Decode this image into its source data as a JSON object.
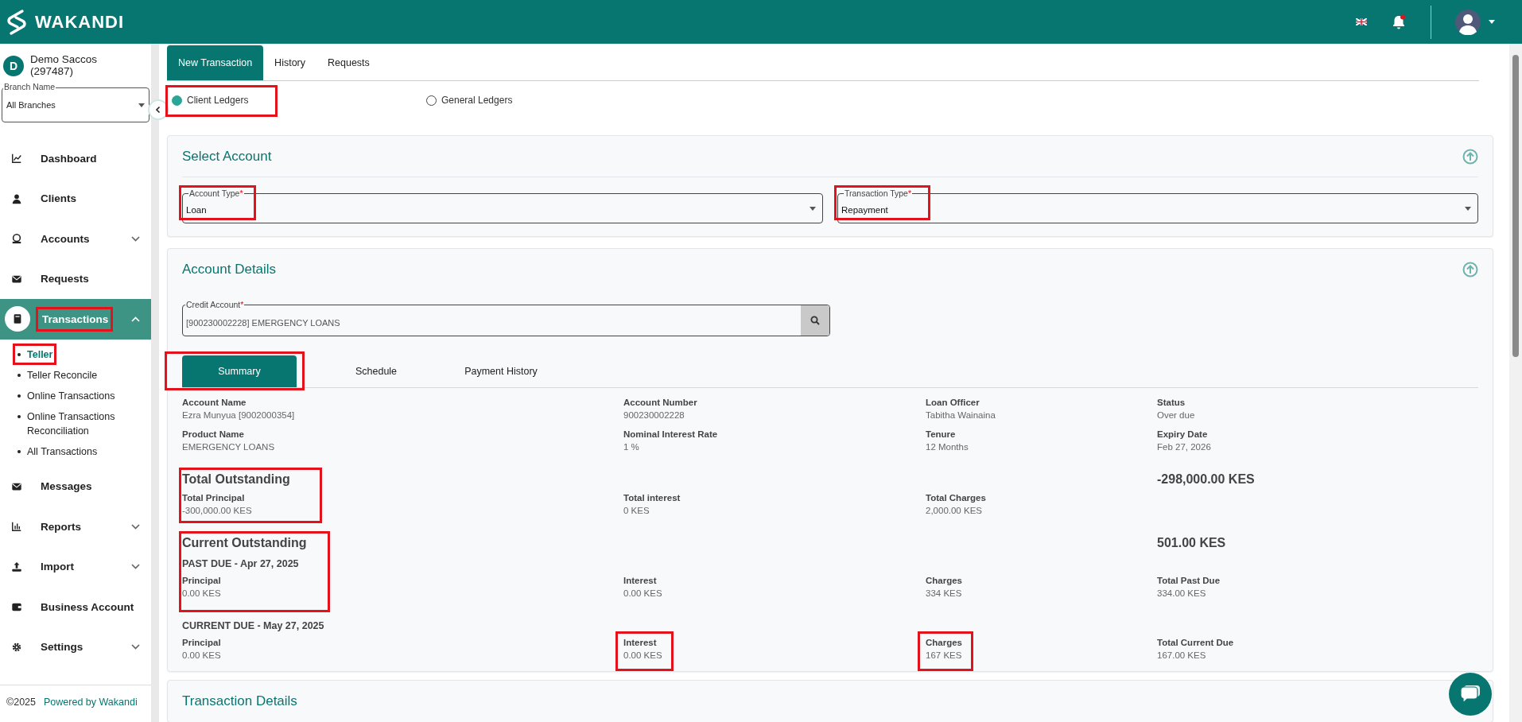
{
  "header": {
    "brand": "WAKANDI"
  },
  "sidebar": {
    "org_initial": "D",
    "org_name": "Demo Saccos",
    "org_code": "(297487)",
    "branch": {
      "label": "Branch Name",
      "value": "All Branches"
    },
    "items": [
      {
        "label": "Dashboard",
        "selected": false,
        "annotated": false
      },
      {
        "label": "Clients",
        "selected": false,
        "annotated": false
      },
      {
        "label": "Accounts",
        "selected": false,
        "annotated": false,
        "expanded": false
      },
      {
        "label": "Requests",
        "selected": false,
        "annotated": false
      },
      {
        "label": "Transactions",
        "selected": true,
        "annotated": true,
        "expanded": true,
        "children": [
          {
            "label": "Teller",
            "selected": true,
            "annotated": true
          },
          {
            "label": "Teller Reconcile",
            "selected": false,
            "annotated": false
          },
          {
            "label": "Online Transactions",
            "selected": false,
            "annotated": false
          },
          {
            "label": "Online Transactions Reconciliation",
            "selected": false,
            "annotated": false
          },
          {
            "label": "All Transactions",
            "selected": false,
            "annotated": false
          }
        ]
      },
      {
        "label": "Messages",
        "selected": false,
        "annotated": false
      },
      {
        "label": "Reports",
        "selected": false,
        "annotated": false,
        "expanded": false
      },
      {
        "label": "Import",
        "selected": false,
        "annotated": false,
        "expanded": false
      },
      {
        "label": "Business Account",
        "selected": false,
        "annotated": false
      },
      {
        "label": "Settings",
        "selected": false,
        "annotated": false,
        "expanded": false
      }
    ],
    "footer": {
      "copyright": "©2025",
      "link": "Powered by Wakandi"
    }
  },
  "tabs": [
    {
      "label": "New Transaction",
      "selected": true
    },
    {
      "label": "History",
      "selected": false
    },
    {
      "label": "Requests",
      "selected": false
    }
  ],
  "ledger_options": [
    {
      "label": "Client Ledgers",
      "selected": true,
      "annotated": true
    },
    {
      "label": "General Ledgers",
      "selected": false,
      "annotated": false
    }
  ],
  "select_account": {
    "title": "Select Account",
    "fields": [
      {
        "label": "Account Type",
        "required_mark": "*",
        "value": "Loan",
        "annotated": true
      },
      {
        "label": "Transaction Type",
        "required_mark": "*",
        "value": "Repayment",
        "annotated": true
      }
    ]
  },
  "account_details": {
    "title": "Account Details",
    "credit_account": {
      "label": "Credit Account",
      "required_mark": "*",
      "value": "[900230002228] EMERGENCY LOANS"
    },
    "tabs": [
      {
        "label": "Summary",
        "selected": true,
        "annotated": true
      },
      {
        "label": "Schedule",
        "selected": false,
        "annotated": false
      },
      {
        "label": "Payment History",
        "selected": false,
        "annotated": false
      }
    ],
    "details": [
      {
        "label": "Account Name",
        "value": "Ezra Munyua [9002000354]"
      },
      {
        "label": "Account Number",
        "value": "900230002228"
      },
      {
        "label": "Loan Officer",
        "value": "Tabitha Wainaina"
      },
      {
        "label": "Status",
        "value": "Over due"
      },
      {
        "label": "Product Name",
        "value": "EMERGENCY LOANS"
      },
      {
        "label": "Nominal Interest Rate",
        "value": "1 %"
      },
      {
        "label": "Tenure",
        "value": "12 Months"
      },
      {
        "label": "Expiry Date",
        "value": "Feb 27, 2026"
      }
    ],
    "outstanding": [
      {
        "title": "Total Outstanding",
        "total": "-298,000.00 KES",
        "annotated": true,
        "groups": [
          {
            "items": [
              {
                "label": "Total Principal",
                "value": "-300,000.00 KES",
                "annotated": false
              },
              {
                "label": "Total interest",
                "value": "0 KES",
                "annotated": false
              },
              {
                "label": "Total Charges",
                "value": "2,000.00 KES",
                "annotated": false
              }
            ]
          }
        ]
      },
      {
        "title": "Current Outstanding",
        "total": "501.00 KES",
        "annotated": true,
        "groups": [
          {
            "heading": "PAST DUE - Apr 27, 2025",
            "items": [
              {
                "label": "Principal",
                "value": "0.00 KES",
                "annotated": false
              },
              {
                "label": "Interest",
                "value": "0.00 KES",
                "annotated": false
              },
              {
                "label": "Charges",
                "value": "334 KES",
                "annotated": false
              },
              {
                "label": "Total Past Due",
                "value": "334.00 KES",
                "annotated": false
              }
            ]
          },
          {
            "heading": "CURRENT DUE - May 27, 2025",
            "items": [
              {
                "label": "Principal",
                "value": "0.00 KES",
                "annotated": false
              },
              {
                "label": "Interest",
                "value": "0.00 KES",
                "annotated": true
              },
              {
                "label": "Charges",
                "value": "167 KES",
                "annotated": true
              },
              {
                "label": "Total Current Due",
                "value": "167.00 KES",
                "annotated": false
              }
            ]
          }
        ]
      }
    ]
  },
  "transaction_details": {
    "title": "Transaction Details"
  }
}
